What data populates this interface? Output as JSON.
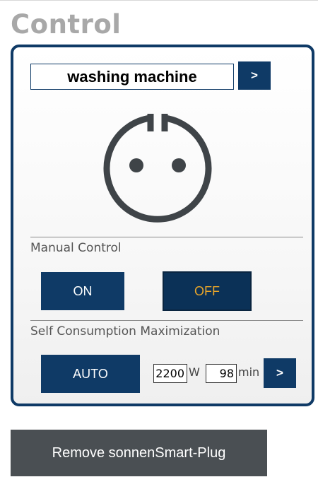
{
  "page": {
    "heading": "Control"
  },
  "device": {
    "name": "washing machine",
    "next_label": ">",
    "icon": "power-socket-icon"
  },
  "manual_control": {
    "label": "Manual Control",
    "on_label": "ON",
    "off_label": "OFF",
    "state": "OFF"
  },
  "self_consumption": {
    "label": "Self Consumption Maximization",
    "auto_label": "AUTO",
    "power_value": "2200",
    "power_unit": "W",
    "duration_value": "98",
    "duration_unit": "min",
    "apply_label": ">"
  },
  "footer": {
    "remove_label": "Remove sonnenSmart-Plug"
  },
  "colors": {
    "brand_navy": "#0f3a66",
    "off_active_text": "#e8a52a",
    "heading_gray": "#a8a8a8",
    "remove_button_bg": "#4a4f53"
  }
}
